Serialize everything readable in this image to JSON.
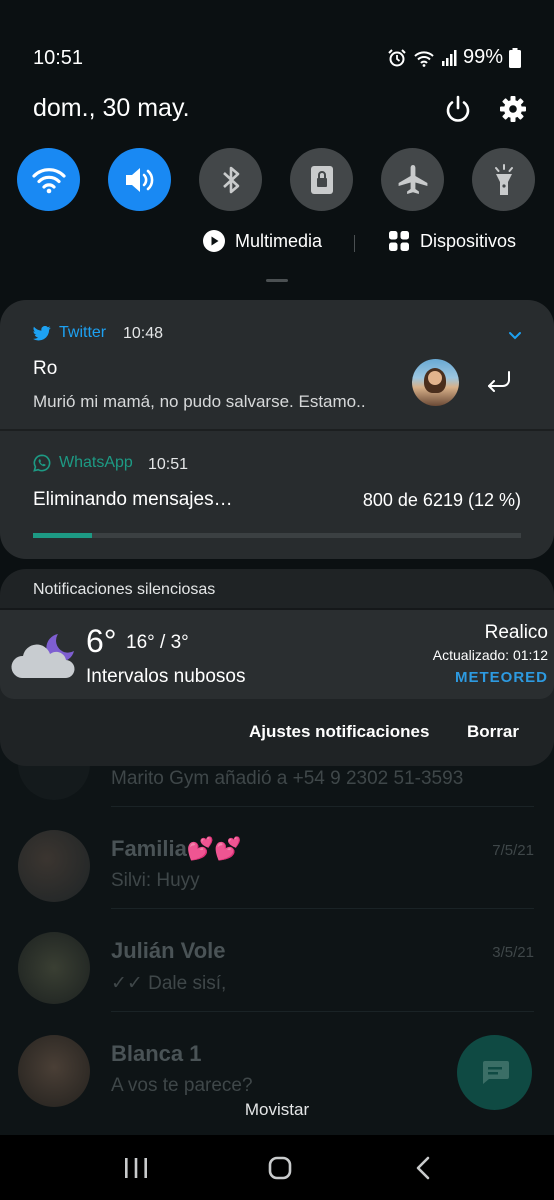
{
  "status_bar": {
    "time": "10:51",
    "battery": "99%"
  },
  "header": {
    "date": "dom., 30 may."
  },
  "quick_settings": [
    {
      "name": "wifi",
      "active": true
    },
    {
      "name": "sound",
      "active": true
    },
    {
      "name": "bluetooth",
      "active": false
    },
    {
      "name": "screen-lock",
      "active": false
    },
    {
      "name": "airplane-mode",
      "active": false
    },
    {
      "name": "flashlight",
      "active": false
    }
  ],
  "media_controls": {
    "media_label": "Multimedia",
    "devices_label": "Dispositivos"
  },
  "twitter_notif": {
    "app": "Twitter",
    "time": "10:48",
    "title": "Ro",
    "text": "Murió mi mamá, no pudo salvarse. Estamo.."
  },
  "whatsapp_notif": {
    "app": "WhatsApp",
    "time": "10:51",
    "title": "Eliminando mensajes…",
    "progress_text": "800 de 6219 (12 %)",
    "progress": 0.12
  },
  "silent": {
    "header": "Notificaciones silenciosas",
    "weather": {
      "temp": "6°",
      "range": "16° / 3°",
      "condition": "Intervalos nubosos",
      "city": "Realico",
      "updated": "Actualizado: 01:12",
      "brand": "METEORED"
    }
  },
  "actions": {
    "settings_label": "Ajustes notificaciones",
    "clear_label": "Borrar"
  },
  "background_chats": [
    {
      "name": "",
      "message": "Marito Gym añadió a +54 9 2302 51-3593",
      "date": ""
    },
    {
      "name": "Familia💕💕",
      "message": "Silvi: Huyy",
      "date": "7/5/21"
    },
    {
      "name": "Julián Vole",
      "message": "✓✓ Dale sisí,",
      "date": "3/5/21"
    },
    {
      "name": "Blanca 1",
      "message": "A vos te parece?",
      "date": ""
    }
  ],
  "carrier": "Movistar",
  "colors": {
    "accent": "#1989f3",
    "whatsapp": "#1d9a84",
    "twitter": "#1da1f2",
    "card": "#282c2e"
  }
}
